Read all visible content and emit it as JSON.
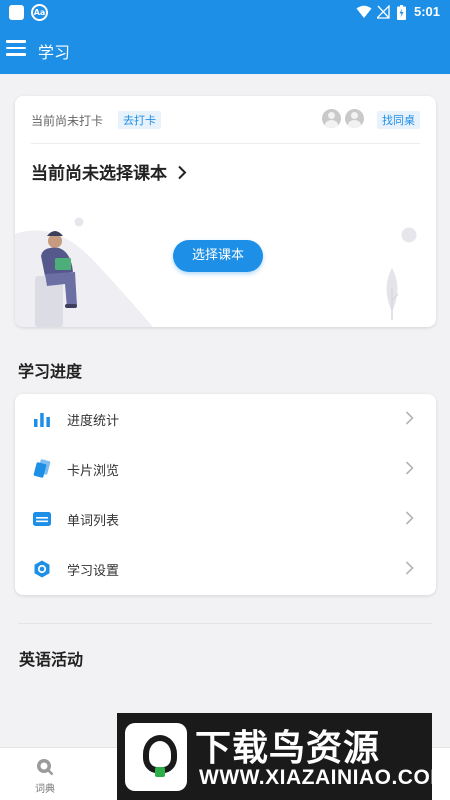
{
  "status_bar": {
    "time": "5:01"
  },
  "app_bar": {
    "title": "学习"
  },
  "checkin_card": {
    "status_text": "当前尚未打卡",
    "checkin_link": "去打卡",
    "find_desk_link": "找同桌",
    "textbook_status": "当前尚未选择课本",
    "select_textbook_button": "选择课本"
  },
  "progress_section": {
    "title": "学习进度",
    "items": [
      {
        "label": "进度统计",
        "icon": "bar-chart-icon"
      },
      {
        "label": "卡片浏览",
        "icon": "cards-icon"
      },
      {
        "label": "单词列表",
        "icon": "word-list-icon"
      },
      {
        "label": "学习设置",
        "icon": "settings-hex-icon"
      }
    ]
  },
  "activity_section": {
    "title": "英语活动"
  },
  "bottom_nav": {
    "items": [
      {
        "label": "词典",
        "icon": "search-icon"
      }
    ]
  },
  "watermark": {
    "brand": "下载鸟资源",
    "url": "WWW.XIAZAINIAO.COM"
  },
  "colors": {
    "primary": "#1e8fe6",
    "background": "#f2f2f4",
    "tag_bg": "#e8f2fc"
  }
}
